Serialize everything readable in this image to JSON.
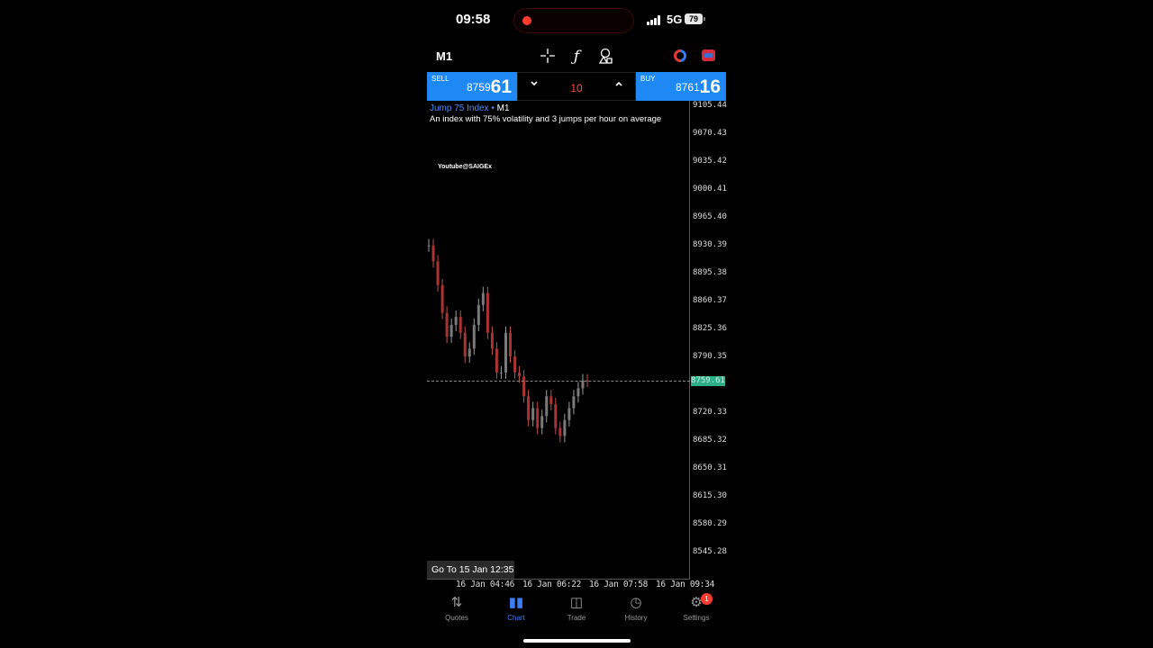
{
  "status": {
    "time": "09:58",
    "network": "5G",
    "battery": "79"
  },
  "toolbar": {
    "timeframe": "M1",
    "crosshair_icon": "crosshair-icon",
    "indicators_icon": "function-icon",
    "objects_icon": "shapes-icon",
    "timer_icon": "clock-icon",
    "switch_icon": "switch-icon"
  },
  "trade": {
    "sell_label": "SELL",
    "sell_price_main": "8759.",
    "sell_price_big": "61",
    "buy_label": "BUY",
    "buy_price_main": "8761.",
    "buy_price_big": "16",
    "volume": "10",
    "vol_down_icon": "chevron-down-icon",
    "vol_up_icon": "chevron-up-icon"
  },
  "chart": {
    "symbol": "Jump 75 Index",
    "separator": " • ",
    "timeframe": "M1",
    "description": "An index with 75% volatility and 3 jumps per hour on average",
    "watermark": "Youtube@SAIGEx",
    "current_price": "8759.61",
    "y_ticks": [
      "9105.44",
      "9070.43",
      "9035.42",
      "9000.41",
      "8965.40",
      "8930.39",
      "8895.38",
      "8860.37",
      "8825.36",
      "8790.35",
      "8720.33",
      "8685.32",
      "8650.31",
      "8615.30",
      "8580.29",
      "8545.28"
    ],
    "x_ticks": [
      "16 Jan 04:46",
      "16 Jan 06:22",
      "16 Jan 07:58",
      "16 Jan 09:34"
    ],
    "goto_label": "Go To 15 Jan 12:35"
  },
  "chart_data": {
    "type": "line",
    "title": "",
    "ylim": [
      8540,
      9110
    ],
    "current": 8759.61,
    "x": [
      "16 Jan 04:46",
      "",
      "",
      "",
      "",
      "",
      "",
      "",
      "",
      "",
      "",
      "",
      "",
      "",
      "",
      "",
      "",
      "",
      "16 Jan 06:22",
      "",
      "",
      "",
      "",
      "",
      "",
      "",
      "",
      "",
      "",
      "",
      "",
      "",
      "16 Jan 07:58",
      "",
      "",
      "",
      "",
      ""
    ],
    "values": [
      8930,
      8910,
      8880,
      8845,
      8815,
      8830,
      8840,
      8820,
      8790,
      8800,
      8830,
      8855,
      8870,
      8820,
      8800,
      8770,
      8770,
      8820,
      8790,
      8770,
      8765,
      8740,
      8710,
      8725,
      8700,
      8715,
      8740,
      8730,
      8700,
      8690,
      8710,
      8725,
      8740,
      8750,
      8760,
      8759.61
    ]
  },
  "nav": [
    {
      "label": "Quotes",
      "icon": "quotes-icon",
      "glyph": "⇅"
    },
    {
      "label": "Chart",
      "icon": "chart-icon",
      "glyph": "▮▮"
    },
    {
      "label": "Trade",
      "icon": "trade-icon",
      "glyph": "◫"
    },
    {
      "label": "History",
      "icon": "history-icon",
      "glyph": "◷"
    },
    {
      "label": "Settings",
      "icon": "gear-icon",
      "glyph": "⚙",
      "badge": "1"
    }
  ]
}
